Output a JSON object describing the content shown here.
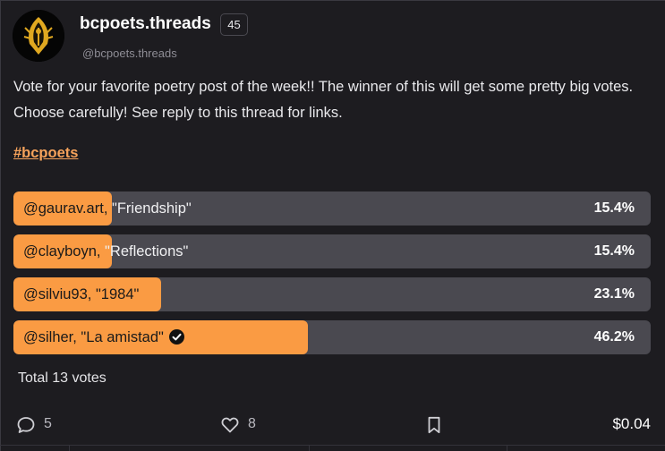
{
  "post": {
    "author": "bcpoets.threads",
    "reputation": "45",
    "handle": "@bcpoets.threads",
    "body": "Vote for your favorite poetry post of the week!! The winner of this will get some pretty big votes. Choose carefully! See reply to this thread for links.",
    "hashtag": "#bcpoets"
  },
  "poll": {
    "options": [
      {
        "user": "@gaurav.art,",
        "title": " \"Friendship\"",
        "percent_label": "15.4%",
        "percent": 15.4
      },
      {
        "user": "@clayboyn,",
        "title": " \"Reflections\"",
        "percent_label": "15.4%",
        "percent": 15.4
      },
      {
        "user": "@silviu93, \"1984\"",
        "title": "",
        "percent_label": "23.1%",
        "percent": 23.1
      },
      {
        "user": "@silher, \"La amistad\"",
        "title": "",
        "percent_label": "46.2%",
        "percent": 46.2,
        "voted": true
      }
    ],
    "total_label": "Total 13 votes"
  },
  "footer": {
    "comments": "5",
    "likes": "8",
    "payout": "$0.04"
  },
  "icons": {
    "avatar": "fountain-pen-logo",
    "voted": "check-circle-icon",
    "comments": "comment-icon",
    "likes": "heart-icon",
    "bookmark": "bookmark-icon"
  },
  "colors": {
    "background": "#1d1c20",
    "accent": "#fa9b43",
    "bar_track": "#4a4950",
    "hashtag": "#f5a25b"
  }
}
